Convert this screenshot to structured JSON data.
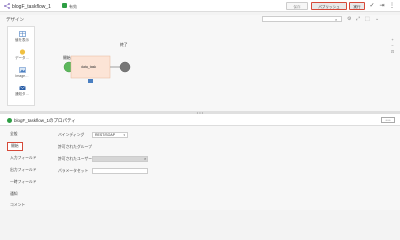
{
  "header": {
    "title": "blogF_taskflow_1",
    "status": "有効",
    "save_label": "保存",
    "publish_label": "パブリッシュ",
    "run_label": "実行"
  },
  "design": {
    "title": "デザイン",
    "palette": [
      {
        "label": "値を表示",
        "icon": "table-icon"
      },
      {
        "label": "データ…",
        "icon": "data-task-icon"
      },
      {
        "label": "Image…",
        "icon": "image-icon"
      },
      {
        "label": "通知タ…",
        "icon": "notification-icon"
      }
    ],
    "nodes": {
      "start": "開始",
      "task": "data_task",
      "end": "終了"
    }
  },
  "properties": {
    "title": "blogF_taskflow_1のプロパティ",
    "more_label": "• • •",
    "tabs": [
      "全般",
      "開始",
      "入力フィールド",
      "出力フィールド",
      "一時フィールド",
      "通知",
      "コメント"
    ],
    "active_tab": "開始",
    "fields": {
      "binding_label": "バインディング",
      "binding_value": "REST/SOAP",
      "groups_label": "許可されたグループ",
      "users_label": "許可されたユーザー",
      "param_label": "パラメータセット"
    }
  },
  "colors": {
    "accent_red": "#d64a3a",
    "start_green": "#5cb85c",
    "end_gray": "#777777",
    "task_fill": "#fce4d6"
  }
}
